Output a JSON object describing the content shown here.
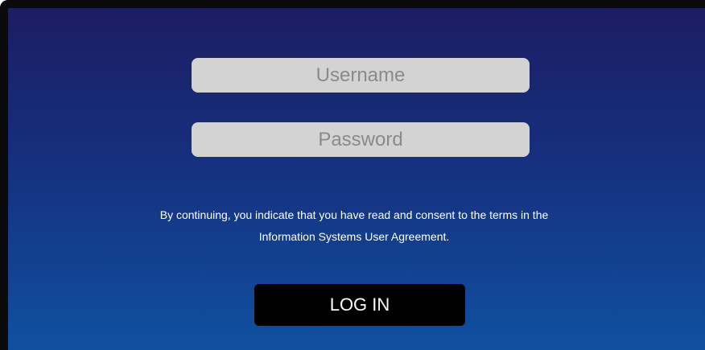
{
  "login_form": {
    "username": {
      "placeholder": "Username",
      "value": ""
    },
    "password": {
      "placeholder": "Password",
      "value": ""
    },
    "consent_text": {
      "line1": "By continuing, you indicate that you have read and consent to the terms in the",
      "line2": "Information Systems User Agreement."
    },
    "login_button_label": "LOG IN"
  },
  "colors": {
    "panel_gradient_top": "#1c1d62",
    "panel_gradient_bottom": "#1050a0",
    "field_background": "#d3d3d3",
    "button_background": "#000000",
    "text_light": "#ffffff"
  }
}
